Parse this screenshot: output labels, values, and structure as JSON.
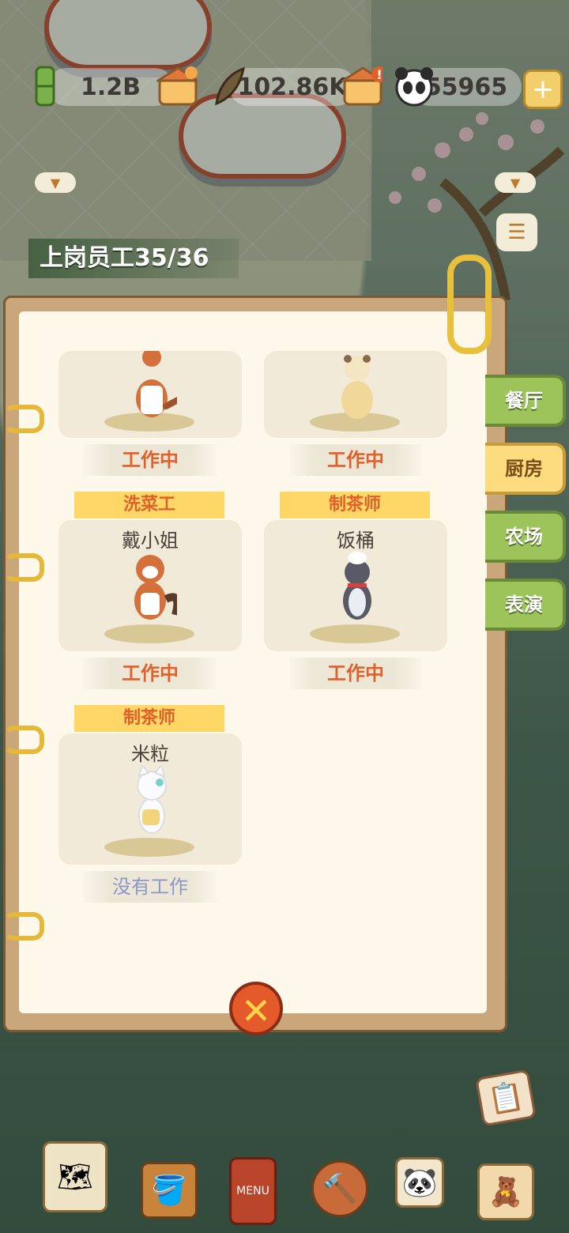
{
  "resources": {
    "bamboo": {
      "icon": "bamboo-icon",
      "value": "1.2B"
    },
    "leaf": {
      "icon": "bamboo-leaf-icon",
      "value": "102.86K"
    },
    "panda": {
      "icon": "panda-icon",
      "value": "55965"
    }
  },
  "staff_banner": "上岗员工35/36",
  "cards": [
    {
      "role": "",
      "name": "",
      "status": "工作中",
      "status_type": "working",
      "character": "fox"
    },
    {
      "role": "",
      "name": "",
      "status": "工作中",
      "status_type": "working",
      "character": "otter"
    },
    {
      "role": "洗菜工",
      "name": "戴小姐",
      "status": "工作中",
      "status_type": "working",
      "character": "red-panda"
    },
    {
      "role": "制茶师",
      "name": "饭桶",
      "status": "工作中",
      "status_type": "working",
      "character": "penguin"
    },
    {
      "role": "制茶师",
      "name": "米粒",
      "status": "没有工作",
      "status_type": "idle",
      "character": "cat"
    }
  ],
  "tabs": [
    {
      "label": "餐厅",
      "active": false
    },
    {
      "label": "厨房",
      "active": true
    },
    {
      "label": "农场",
      "active": false
    },
    {
      "label": "表演",
      "active": false
    }
  ],
  "close_label": "✕",
  "colors": {
    "tab_green": "#9cc45a",
    "tab_active": "#fcdc7e",
    "working": "#e0602a",
    "idle": "#8e95c9"
  }
}
